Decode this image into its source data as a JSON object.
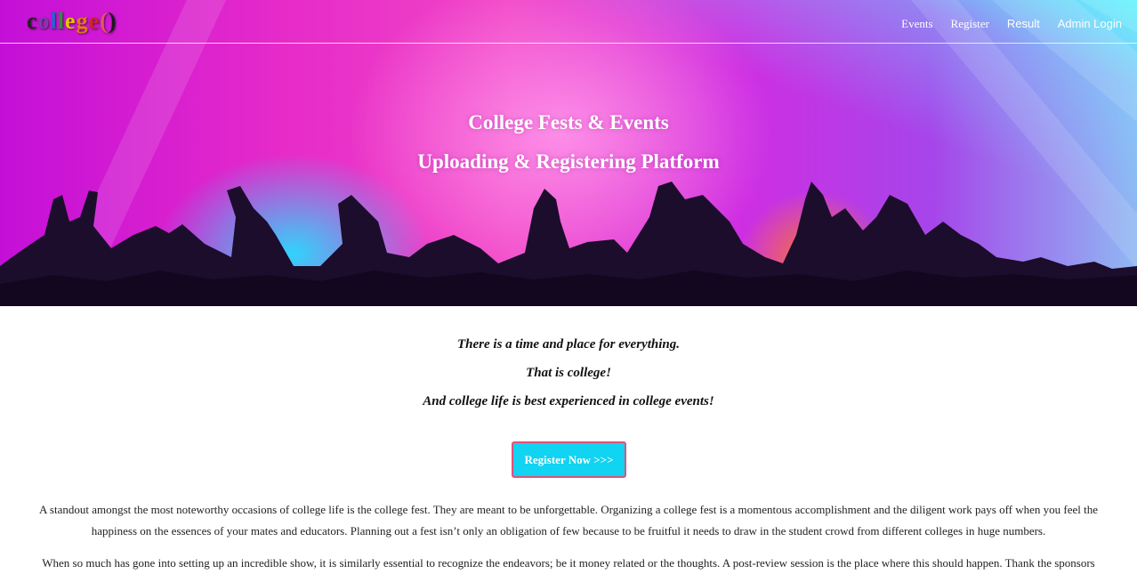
{
  "navbar": {
    "brand": [
      "c",
      "o",
      "l",
      "l",
      "e",
      "g",
      "e",
      "(",
      ")"
    ],
    "brand_colors": [
      "#222222",
      "#7a3ea8",
      "#2f5fd1",
      "#2f8f3a",
      "#e2c400",
      "#e37a12",
      "#d02525",
      "#e35a5a",
      "#1a1a1a"
    ],
    "links": [
      "Events",
      "Register",
      "Result",
      "Admin Login"
    ]
  },
  "hero": {
    "title_line1": "College Fests & Events",
    "title_line2": "Uploading & Registering Platform"
  },
  "intro": {
    "line1": "There is a time and place for everything.",
    "line2": "That is college!",
    "line3": "And college life is best experienced in college events!"
  },
  "cta": {
    "label": "Register Now >>>"
  },
  "content": {
    "paragraph1": "A standout amongst the most noteworthy occasions of college life is the college fest. They are meant to be unforgettable. Organizing a college fest is a momentous accomplishment and the diligent work pays off when you feel the happiness on the essences of your mates and educators. Planning out a fest isn’t only an obligation of few because to be fruitful it needs to draw in the student crowd from different colleges in huge numbers.",
    "paragraph2": "When so much has gone into setting up an incredible show, it is similarly essential to recognize the endeavors; be it money related or the thoughts. A post-review session is the place where this should happen. Thank the sponsors"
  },
  "colors": {
    "accent_button": "#11d3f2",
    "button_border": "#e0527c"
  }
}
